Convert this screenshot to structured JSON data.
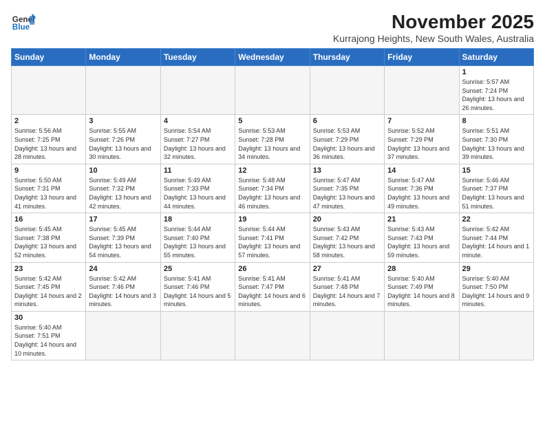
{
  "header": {
    "logo_line1": "General",
    "logo_line2": "Blue",
    "title": "November 2025",
    "subtitle": "Kurrajong Heights, New South Wales, Australia"
  },
  "weekdays": [
    "Sunday",
    "Monday",
    "Tuesday",
    "Wednesday",
    "Thursday",
    "Friday",
    "Saturday"
  ],
  "weeks": [
    [
      {
        "day": "",
        "sunrise": "",
        "sunset": "",
        "daylight": ""
      },
      {
        "day": "",
        "sunrise": "",
        "sunset": "",
        "daylight": ""
      },
      {
        "day": "",
        "sunrise": "",
        "sunset": "",
        "daylight": ""
      },
      {
        "day": "",
        "sunrise": "",
        "sunset": "",
        "daylight": ""
      },
      {
        "day": "",
        "sunrise": "",
        "sunset": "",
        "daylight": ""
      },
      {
        "day": "",
        "sunrise": "",
        "sunset": "",
        "daylight": ""
      },
      {
        "day": "1",
        "sunrise": "Sunrise: 5:57 AM",
        "sunset": "Sunset: 7:24 PM",
        "daylight": "Daylight: 13 hours and 26 minutes."
      }
    ],
    [
      {
        "day": "2",
        "sunrise": "Sunrise: 5:56 AM",
        "sunset": "Sunset: 7:25 PM",
        "daylight": "Daylight: 13 hours and 28 minutes."
      },
      {
        "day": "3",
        "sunrise": "Sunrise: 5:55 AM",
        "sunset": "Sunset: 7:26 PM",
        "daylight": "Daylight: 13 hours and 30 minutes."
      },
      {
        "day": "4",
        "sunrise": "Sunrise: 5:54 AM",
        "sunset": "Sunset: 7:27 PM",
        "daylight": "Daylight: 13 hours and 32 minutes."
      },
      {
        "day": "5",
        "sunrise": "Sunrise: 5:53 AM",
        "sunset": "Sunset: 7:28 PM",
        "daylight": "Daylight: 13 hours and 34 minutes."
      },
      {
        "day": "6",
        "sunrise": "Sunrise: 5:53 AM",
        "sunset": "Sunset: 7:29 PM",
        "daylight": "Daylight: 13 hours and 36 minutes."
      },
      {
        "day": "7",
        "sunrise": "Sunrise: 5:52 AM",
        "sunset": "Sunset: 7:29 PM",
        "daylight": "Daylight: 13 hours and 37 minutes."
      },
      {
        "day": "8",
        "sunrise": "Sunrise: 5:51 AM",
        "sunset": "Sunset: 7:30 PM",
        "daylight": "Daylight: 13 hours and 39 minutes."
      }
    ],
    [
      {
        "day": "9",
        "sunrise": "Sunrise: 5:50 AM",
        "sunset": "Sunset: 7:31 PM",
        "daylight": "Daylight: 13 hours and 41 minutes."
      },
      {
        "day": "10",
        "sunrise": "Sunrise: 5:49 AM",
        "sunset": "Sunset: 7:32 PM",
        "daylight": "Daylight: 13 hours and 42 minutes."
      },
      {
        "day": "11",
        "sunrise": "Sunrise: 5:49 AM",
        "sunset": "Sunset: 7:33 PM",
        "daylight": "Daylight: 13 hours and 44 minutes."
      },
      {
        "day": "12",
        "sunrise": "Sunrise: 5:48 AM",
        "sunset": "Sunset: 7:34 PM",
        "daylight": "Daylight: 13 hours and 46 minutes."
      },
      {
        "day": "13",
        "sunrise": "Sunrise: 5:47 AM",
        "sunset": "Sunset: 7:35 PM",
        "daylight": "Daylight: 13 hours and 47 minutes."
      },
      {
        "day": "14",
        "sunrise": "Sunrise: 5:47 AM",
        "sunset": "Sunset: 7:36 PM",
        "daylight": "Daylight: 13 hours and 49 minutes."
      },
      {
        "day": "15",
        "sunrise": "Sunrise: 5:46 AM",
        "sunset": "Sunset: 7:37 PM",
        "daylight": "Daylight: 13 hours and 51 minutes."
      }
    ],
    [
      {
        "day": "16",
        "sunrise": "Sunrise: 5:45 AM",
        "sunset": "Sunset: 7:38 PM",
        "daylight": "Daylight: 13 hours and 52 minutes."
      },
      {
        "day": "17",
        "sunrise": "Sunrise: 5:45 AM",
        "sunset": "Sunset: 7:39 PM",
        "daylight": "Daylight: 13 hours and 54 minutes."
      },
      {
        "day": "18",
        "sunrise": "Sunrise: 5:44 AM",
        "sunset": "Sunset: 7:40 PM",
        "daylight": "Daylight: 13 hours and 55 minutes."
      },
      {
        "day": "19",
        "sunrise": "Sunrise: 5:44 AM",
        "sunset": "Sunset: 7:41 PM",
        "daylight": "Daylight: 13 hours and 57 minutes."
      },
      {
        "day": "20",
        "sunrise": "Sunrise: 5:43 AM",
        "sunset": "Sunset: 7:42 PM",
        "daylight": "Daylight: 13 hours and 58 minutes."
      },
      {
        "day": "21",
        "sunrise": "Sunrise: 5:43 AM",
        "sunset": "Sunset: 7:43 PM",
        "daylight": "Daylight: 13 hours and 59 minutes."
      },
      {
        "day": "22",
        "sunrise": "Sunrise: 5:42 AM",
        "sunset": "Sunset: 7:44 PM",
        "daylight": "Daylight: 14 hours and 1 minute."
      }
    ],
    [
      {
        "day": "23",
        "sunrise": "Sunrise: 5:42 AM",
        "sunset": "Sunset: 7:45 PM",
        "daylight": "Daylight: 14 hours and 2 minutes."
      },
      {
        "day": "24",
        "sunrise": "Sunrise: 5:42 AM",
        "sunset": "Sunset: 7:46 PM",
        "daylight": "Daylight: 14 hours and 3 minutes."
      },
      {
        "day": "25",
        "sunrise": "Sunrise: 5:41 AM",
        "sunset": "Sunset: 7:46 PM",
        "daylight": "Daylight: 14 hours and 5 minutes."
      },
      {
        "day": "26",
        "sunrise": "Sunrise: 5:41 AM",
        "sunset": "Sunset: 7:47 PM",
        "daylight": "Daylight: 14 hours and 6 minutes."
      },
      {
        "day": "27",
        "sunrise": "Sunrise: 5:41 AM",
        "sunset": "Sunset: 7:48 PM",
        "daylight": "Daylight: 14 hours and 7 minutes."
      },
      {
        "day": "28",
        "sunrise": "Sunrise: 5:40 AM",
        "sunset": "Sunset: 7:49 PM",
        "daylight": "Daylight: 14 hours and 8 minutes."
      },
      {
        "day": "29",
        "sunrise": "Sunrise: 5:40 AM",
        "sunset": "Sunset: 7:50 PM",
        "daylight": "Daylight: 14 hours and 9 minutes."
      }
    ],
    [
      {
        "day": "30",
        "sunrise": "Sunrise: 5:40 AM",
        "sunset": "Sunset: 7:51 PM",
        "daylight": "Daylight: 14 hours and 10 minutes."
      },
      {
        "day": "",
        "sunrise": "",
        "sunset": "",
        "daylight": ""
      },
      {
        "day": "",
        "sunrise": "",
        "sunset": "",
        "daylight": ""
      },
      {
        "day": "",
        "sunrise": "",
        "sunset": "",
        "daylight": ""
      },
      {
        "day": "",
        "sunrise": "",
        "sunset": "",
        "daylight": ""
      },
      {
        "day": "",
        "sunrise": "",
        "sunset": "",
        "daylight": ""
      },
      {
        "day": "",
        "sunrise": "",
        "sunset": "",
        "daylight": ""
      }
    ]
  ]
}
